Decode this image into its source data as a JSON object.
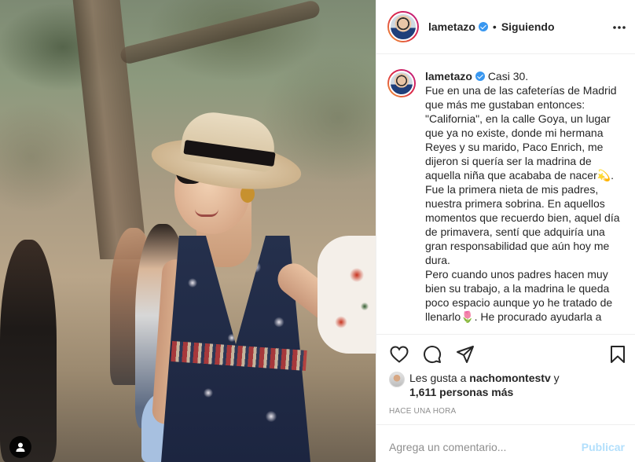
{
  "post": {
    "username": "lametazo",
    "verified": true,
    "separator": "•",
    "follow_status": "Siguiendo",
    "more_icon": "more-horizontal-icon",
    "caption_lines": [
      "Casi 30.",
      "Fue en una de las cafeterías de Madrid que más me gustaban entonces: \"California\", en la calle Goya, un lugar que ya no existe, donde mi hermana Reyes y su marido, Paco Enrich, me dijeron si quería ser la madrina de aquella niña que acababa de nacer💫.",
      "Fue la primera nieta de mis padres, nuestra primera sobrina. En aquellos momentos que recuerdo bien, aquel día de primavera, sentí que adquiría una gran responsabilidad que aún hoy me dura.",
      "Pero cuando unos padres hacen muy bien su trabajo, a la madrina le queda poco espacio aunque yo he tratado de llenarlo🌷. He procurado ayudarla a"
    ]
  },
  "actions": {
    "like_icon": "heart-icon",
    "comment_icon": "comment-icon",
    "share_icon": "share-icon",
    "save_icon": "bookmark-icon"
  },
  "likes": {
    "prefix": "Les gusta a",
    "first_liker": "nachomontestv",
    "conjunction": "y",
    "others": "1,611 personas más"
  },
  "timestamp": "Hace una hora",
  "comment": {
    "placeholder": "Agrega un comentario...",
    "submit_label": "Publicar"
  },
  "photo": {
    "user_tag_icon": "user-tag-icon"
  },
  "colors": {
    "accent_blue": "#3897f0",
    "publish_disabled": "#b2dffc",
    "text": "#262626",
    "muted": "#8e8e8e"
  }
}
